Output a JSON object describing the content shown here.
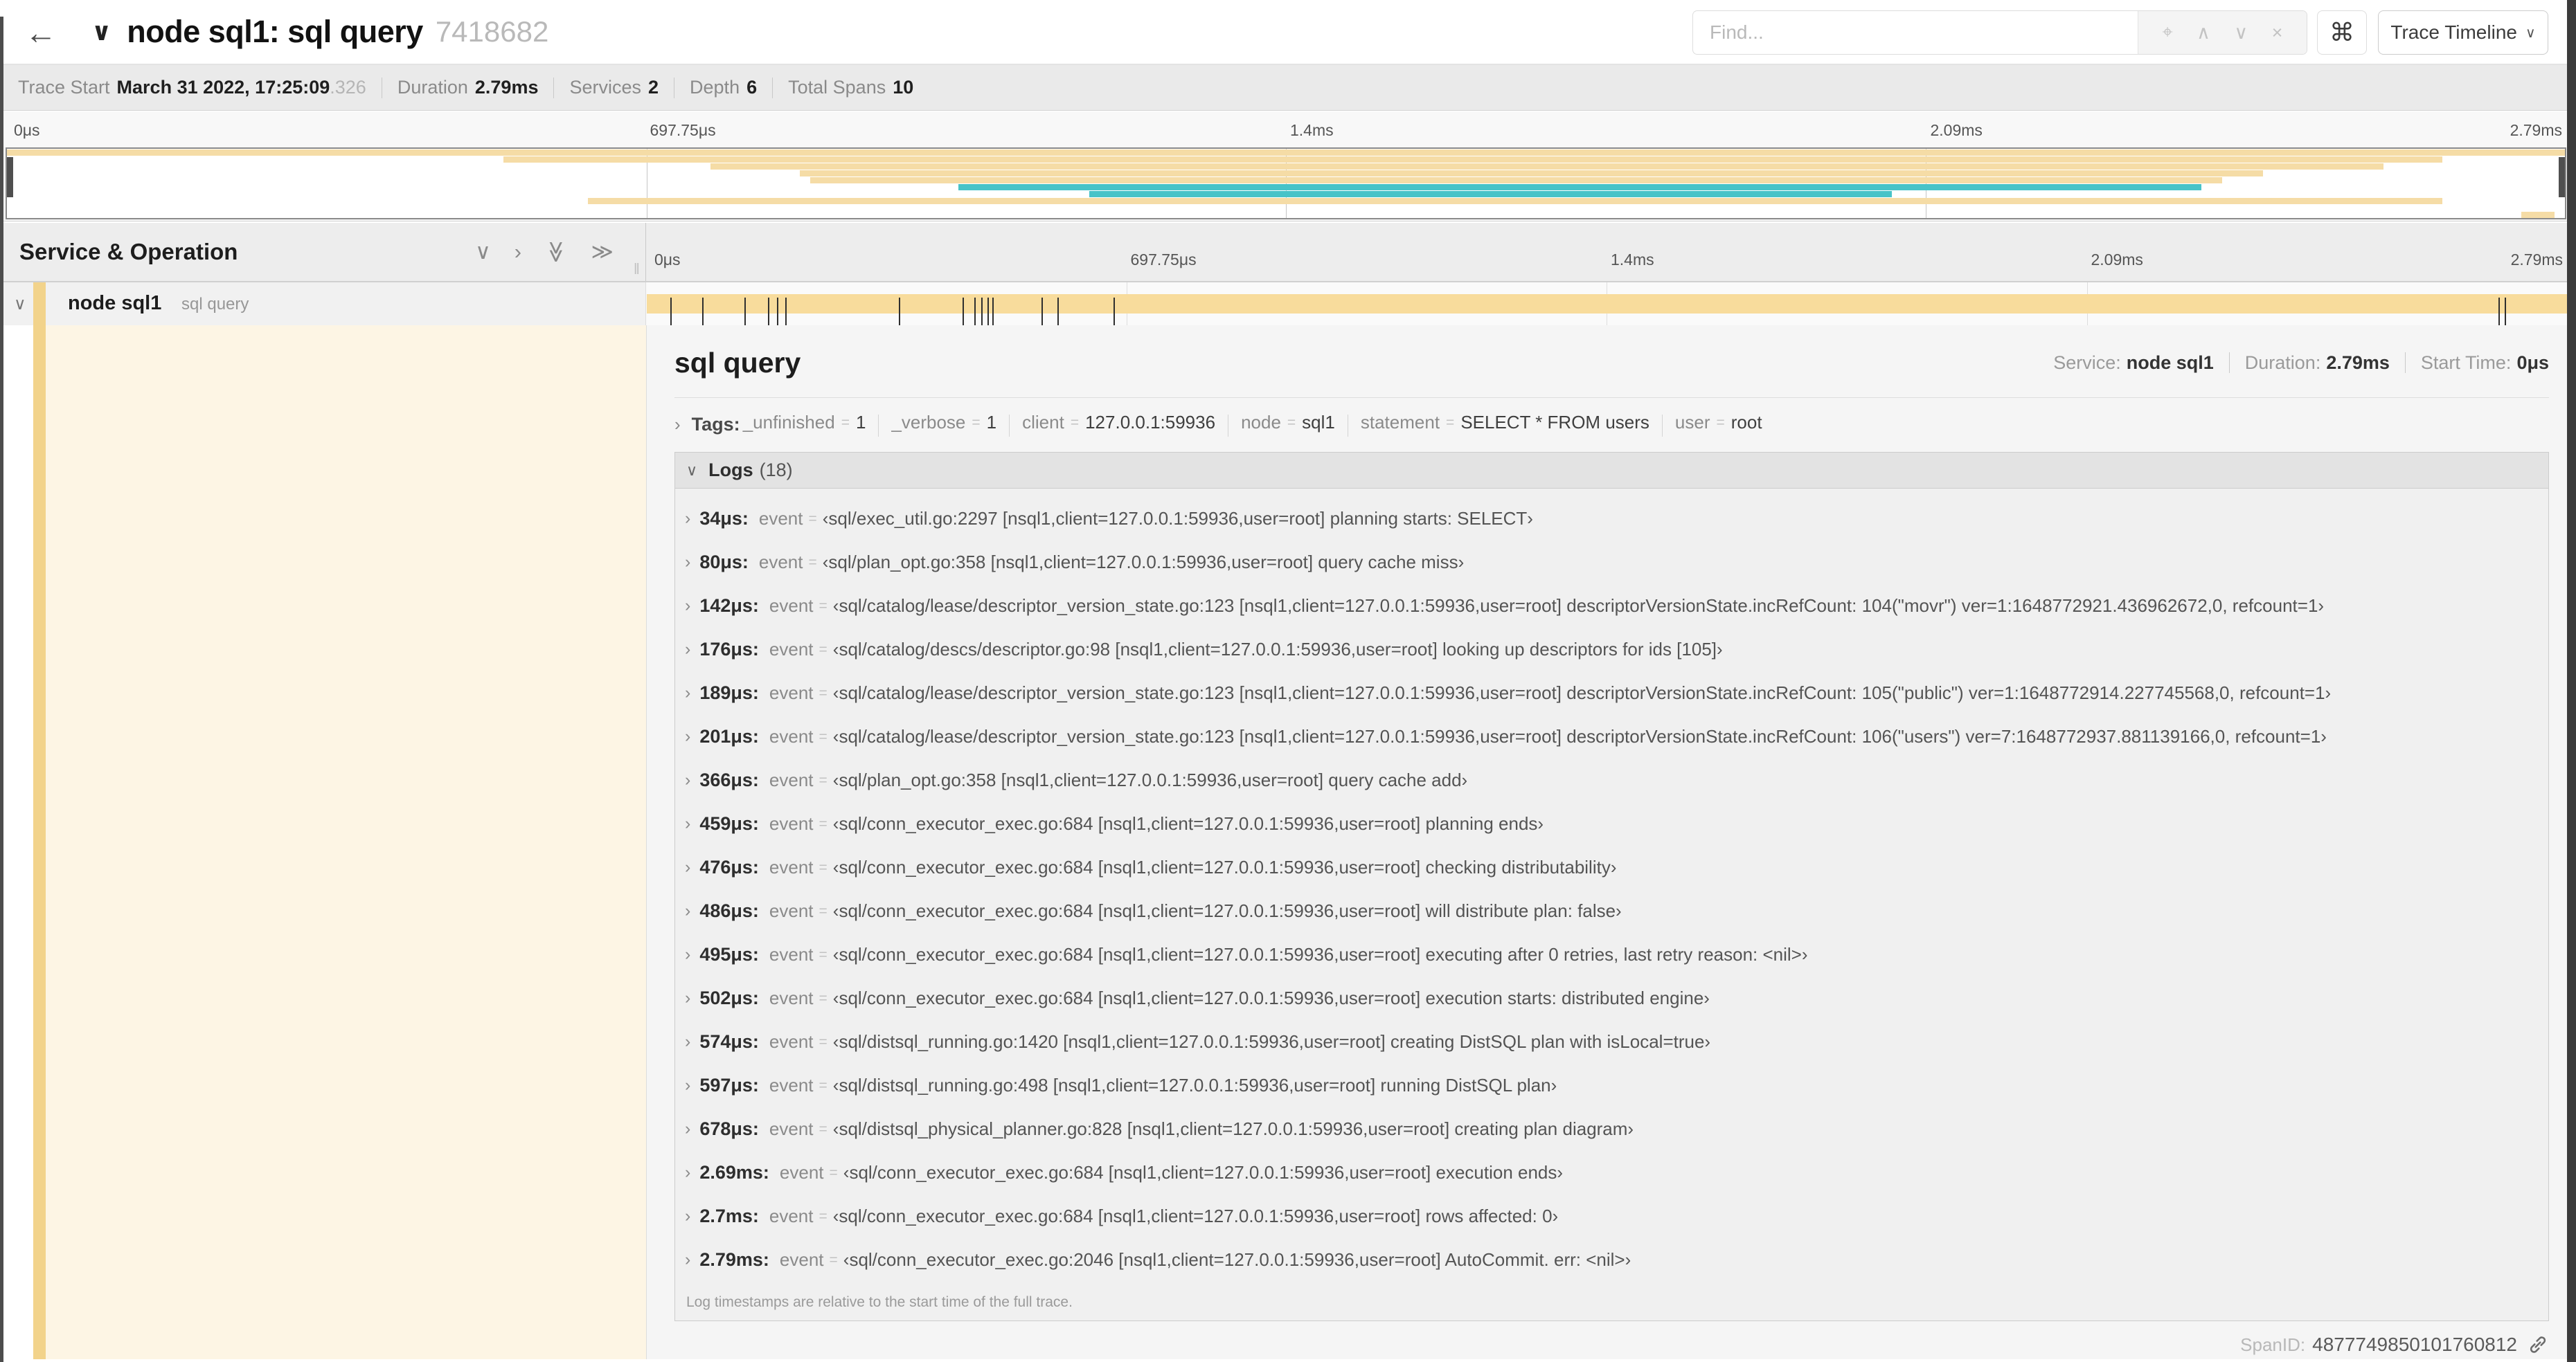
{
  "header": {
    "back_icon": "←",
    "collapse_icon": "∨",
    "title": "node sql1: sql query",
    "trace_id_short": "7418682",
    "find_placeholder": "Find...",
    "find_icons": [
      {
        "glyph": "⌖",
        "name": "find-target-icon"
      },
      {
        "glyph": "∧",
        "name": "find-prev-icon"
      },
      {
        "glyph": "∨",
        "name": "find-next-icon"
      },
      {
        "glyph": "×",
        "name": "find-clear-icon"
      }
    ],
    "shortcut_icon": "⌘",
    "view_selector": "Trace Timeline",
    "view_selector_chevron": "∨"
  },
  "summary": {
    "items": [
      {
        "label": "Trace Start",
        "value": "March 31 2022, 17:25:09",
        "suffix": ".326"
      },
      {
        "label": "Duration",
        "value": "2.79ms"
      },
      {
        "label": "Services",
        "value": "2"
      },
      {
        "label": "Depth",
        "value": "6"
      },
      {
        "label": "Total Spans",
        "value": "10"
      }
    ]
  },
  "minimap": {
    "axis_labels": [
      "0μs",
      "697.75μs",
      "1.4ms",
      "2.09ms",
      "2.79ms"
    ],
    "colors": {
      "tan": "#F5DCA6",
      "teal": "#47C3C8"
    },
    "spans": [
      {
        "start": 0,
        "end": 100,
        "color": "tan"
      },
      {
        "start": 19.4,
        "end": 95.2,
        "color": "tan"
      },
      {
        "start": 27.5,
        "end": 92.9,
        "color": "tan"
      },
      {
        "start": 31.0,
        "end": 88.2,
        "color": "tan"
      },
      {
        "start": 31.4,
        "end": 86.6,
        "color": "tan"
      },
      {
        "start": 37.2,
        "end": 85.8,
        "color": "teal"
      },
      {
        "start": 42.3,
        "end": 73.7,
        "color": "teal"
      },
      {
        "start": 22.7,
        "end": 95.2,
        "color": "tan"
      },
      {
        "start": 0,
        "end": 0,
        "color": "tan"
      },
      {
        "start": 98.3,
        "end": 99.6,
        "color": "tan"
      }
    ]
  },
  "grid": {
    "left_header": "Service & Operation",
    "header_icons": [
      {
        "glyph": "∨",
        "name": "collapse-one-icon",
        "rotate": false
      },
      {
        "glyph": "›",
        "name": "expand-one-icon",
        "rotate": false
      },
      {
        "glyph": "≫",
        "name": "collapse-all-icon",
        "rotate": true
      },
      {
        "glyph": "≫",
        "name": "expand-all-icon",
        "rotate": false
      }
    ],
    "grip_icon": "‖",
    "ruler_labels": [
      "0μs",
      "697.75μs",
      "1.4ms",
      "2.09ms",
      "2.79ms"
    ],
    "row": {
      "chevron": "∨",
      "service": "node sql1",
      "operation": "sql query",
      "total_us": 2790,
      "tick_times_us": [
        34,
        80,
        142,
        176,
        189,
        201,
        366,
        459,
        476,
        486,
        495,
        502,
        574,
        597,
        678,
        2690,
        2700,
        2790
      ]
    }
  },
  "detail": {
    "operation_title": "sql query",
    "info": [
      {
        "label": "Service:",
        "value": "node sql1"
      },
      {
        "label": "Duration:",
        "value": "2.79ms"
      },
      {
        "label": "Start Time:",
        "value": "0μs"
      }
    ],
    "tags": {
      "chevron": "›",
      "label": "Tags:",
      "items": [
        {
          "key": "_unfinished",
          "value": "1"
        },
        {
          "key": "_verbose",
          "value": "1"
        },
        {
          "key": "client",
          "value": "127.0.0.1:59936"
        },
        {
          "key": "node",
          "value": "sql1"
        },
        {
          "key": "statement",
          "value": "SELECT * FROM users"
        },
        {
          "key": "user",
          "value": "root"
        }
      ]
    },
    "logs": {
      "chevron": "∨",
      "label": "Logs",
      "count": "(18)",
      "rows": [
        {
          "time": "34μs:",
          "key": "event",
          "value": "‹sql/exec_util.go:2297 [nsql1,client=127.0.0.1:59936,user=root] planning starts: SELECT›"
        },
        {
          "time": "80μs:",
          "key": "event",
          "value": "‹sql/plan_opt.go:358 [nsql1,client=127.0.0.1:59936,user=root] query cache miss›"
        },
        {
          "time": "142μs:",
          "key": "event",
          "value": "‹sql/catalog/lease/descriptor_version_state.go:123 [nsql1,client=127.0.0.1:59936,user=root] descriptorVersionState.incRefCount: 104(\"movr\") ver=1:1648772921.436962672,0, refcount=1›"
        },
        {
          "time": "176μs:",
          "key": "event",
          "value": "‹sql/catalog/descs/descriptor.go:98 [nsql1,client=127.0.0.1:59936,user=root] looking up descriptors for ids [105]›"
        },
        {
          "time": "189μs:",
          "key": "event",
          "value": "‹sql/catalog/lease/descriptor_version_state.go:123 [nsql1,client=127.0.0.1:59936,user=root] descriptorVersionState.incRefCount: 105(\"public\") ver=1:1648772914.227745568,0, refcount=1›"
        },
        {
          "time": "201μs:",
          "key": "event",
          "value": "‹sql/catalog/lease/descriptor_version_state.go:123 [nsql1,client=127.0.0.1:59936,user=root] descriptorVersionState.incRefCount: 106(\"users\") ver=7:1648772937.881139166,0, refcount=1›"
        },
        {
          "time": "366μs:",
          "key": "event",
          "value": "‹sql/plan_opt.go:358 [nsql1,client=127.0.0.1:59936,user=root] query cache add›"
        },
        {
          "time": "459μs:",
          "key": "event",
          "value": "‹sql/conn_executor_exec.go:684 [nsql1,client=127.0.0.1:59936,user=root] planning ends›"
        },
        {
          "time": "476μs:",
          "key": "event",
          "value": "‹sql/conn_executor_exec.go:684 [nsql1,client=127.0.0.1:59936,user=root] checking distributability›"
        },
        {
          "time": "486μs:",
          "key": "event",
          "value": "‹sql/conn_executor_exec.go:684 [nsql1,client=127.0.0.1:59936,user=root] will distribute plan: false›"
        },
        {
          "time": "495μs:",
          "key": "event",
          "value": "‹sql/conn_executor_exec.go:684 [nsql1,client=127.0.0.1:59936,user=root] executing after 0 retries, last retry reason: <nil>›"
        },
        {
          "time": "502μs:",
          "key": "event",
          "value": "‹sql/conn_executor_exec.go:684 [nsql1,client=127.0.0.1:59936,user=root] execution starts: distributed engine›"
        },
        {
          "time": "574μs:",
          "key": "event",
          "value": "‹sql/distsql_running.go:1420 [nsql1,client=127.0.0.1:59936,user=root] creating DistSQL plan with isLocal=true›"
        },
        {
          "time": "597μs:",
          "key": "event",
          "value": "‹sql/distsql_running.go:498 [nsql1,client=127.0.0.1:59936,user=root] running DistSQL plan›"
        },
        {
          "time": "678μs:",
          "key": "event",
          "value": "‹sql/distsql_physical_planner.go:828 [nsql1,client=127.0.0.1:59936,user=root] creating plan diagram›"
        },
        {
          "time": "2.69ms:",
          "key": "event",
          "value": "‹sql/conn_executor_exec.go:684 [nsql1,client=127.0.0.1:59936,user=root] execution ends›"
        },
        {
          "time": "2.7ms:",
          "key": "event",
          "value": "‹sql/conn_executor_exec.go:684 [nsql1,client=127.0.0.1:59936,user=root] rows affected: 0›"
        },
        {
          "time": "2.79ms:",
          "key": "event",
          "value": "‹sql/conn_executor_exec.go:2046 [nsql1,client=127.0.0.1:59936,user=root] AutoCommit. err: <nil>›"
        }
      ],
      "footnote": "Log timestamps are relative to the start time of the full trace."
    },
    "span_id": {
      "label": "SpanID:",
      "value": "4877749850101760812"
    }
  }
}
